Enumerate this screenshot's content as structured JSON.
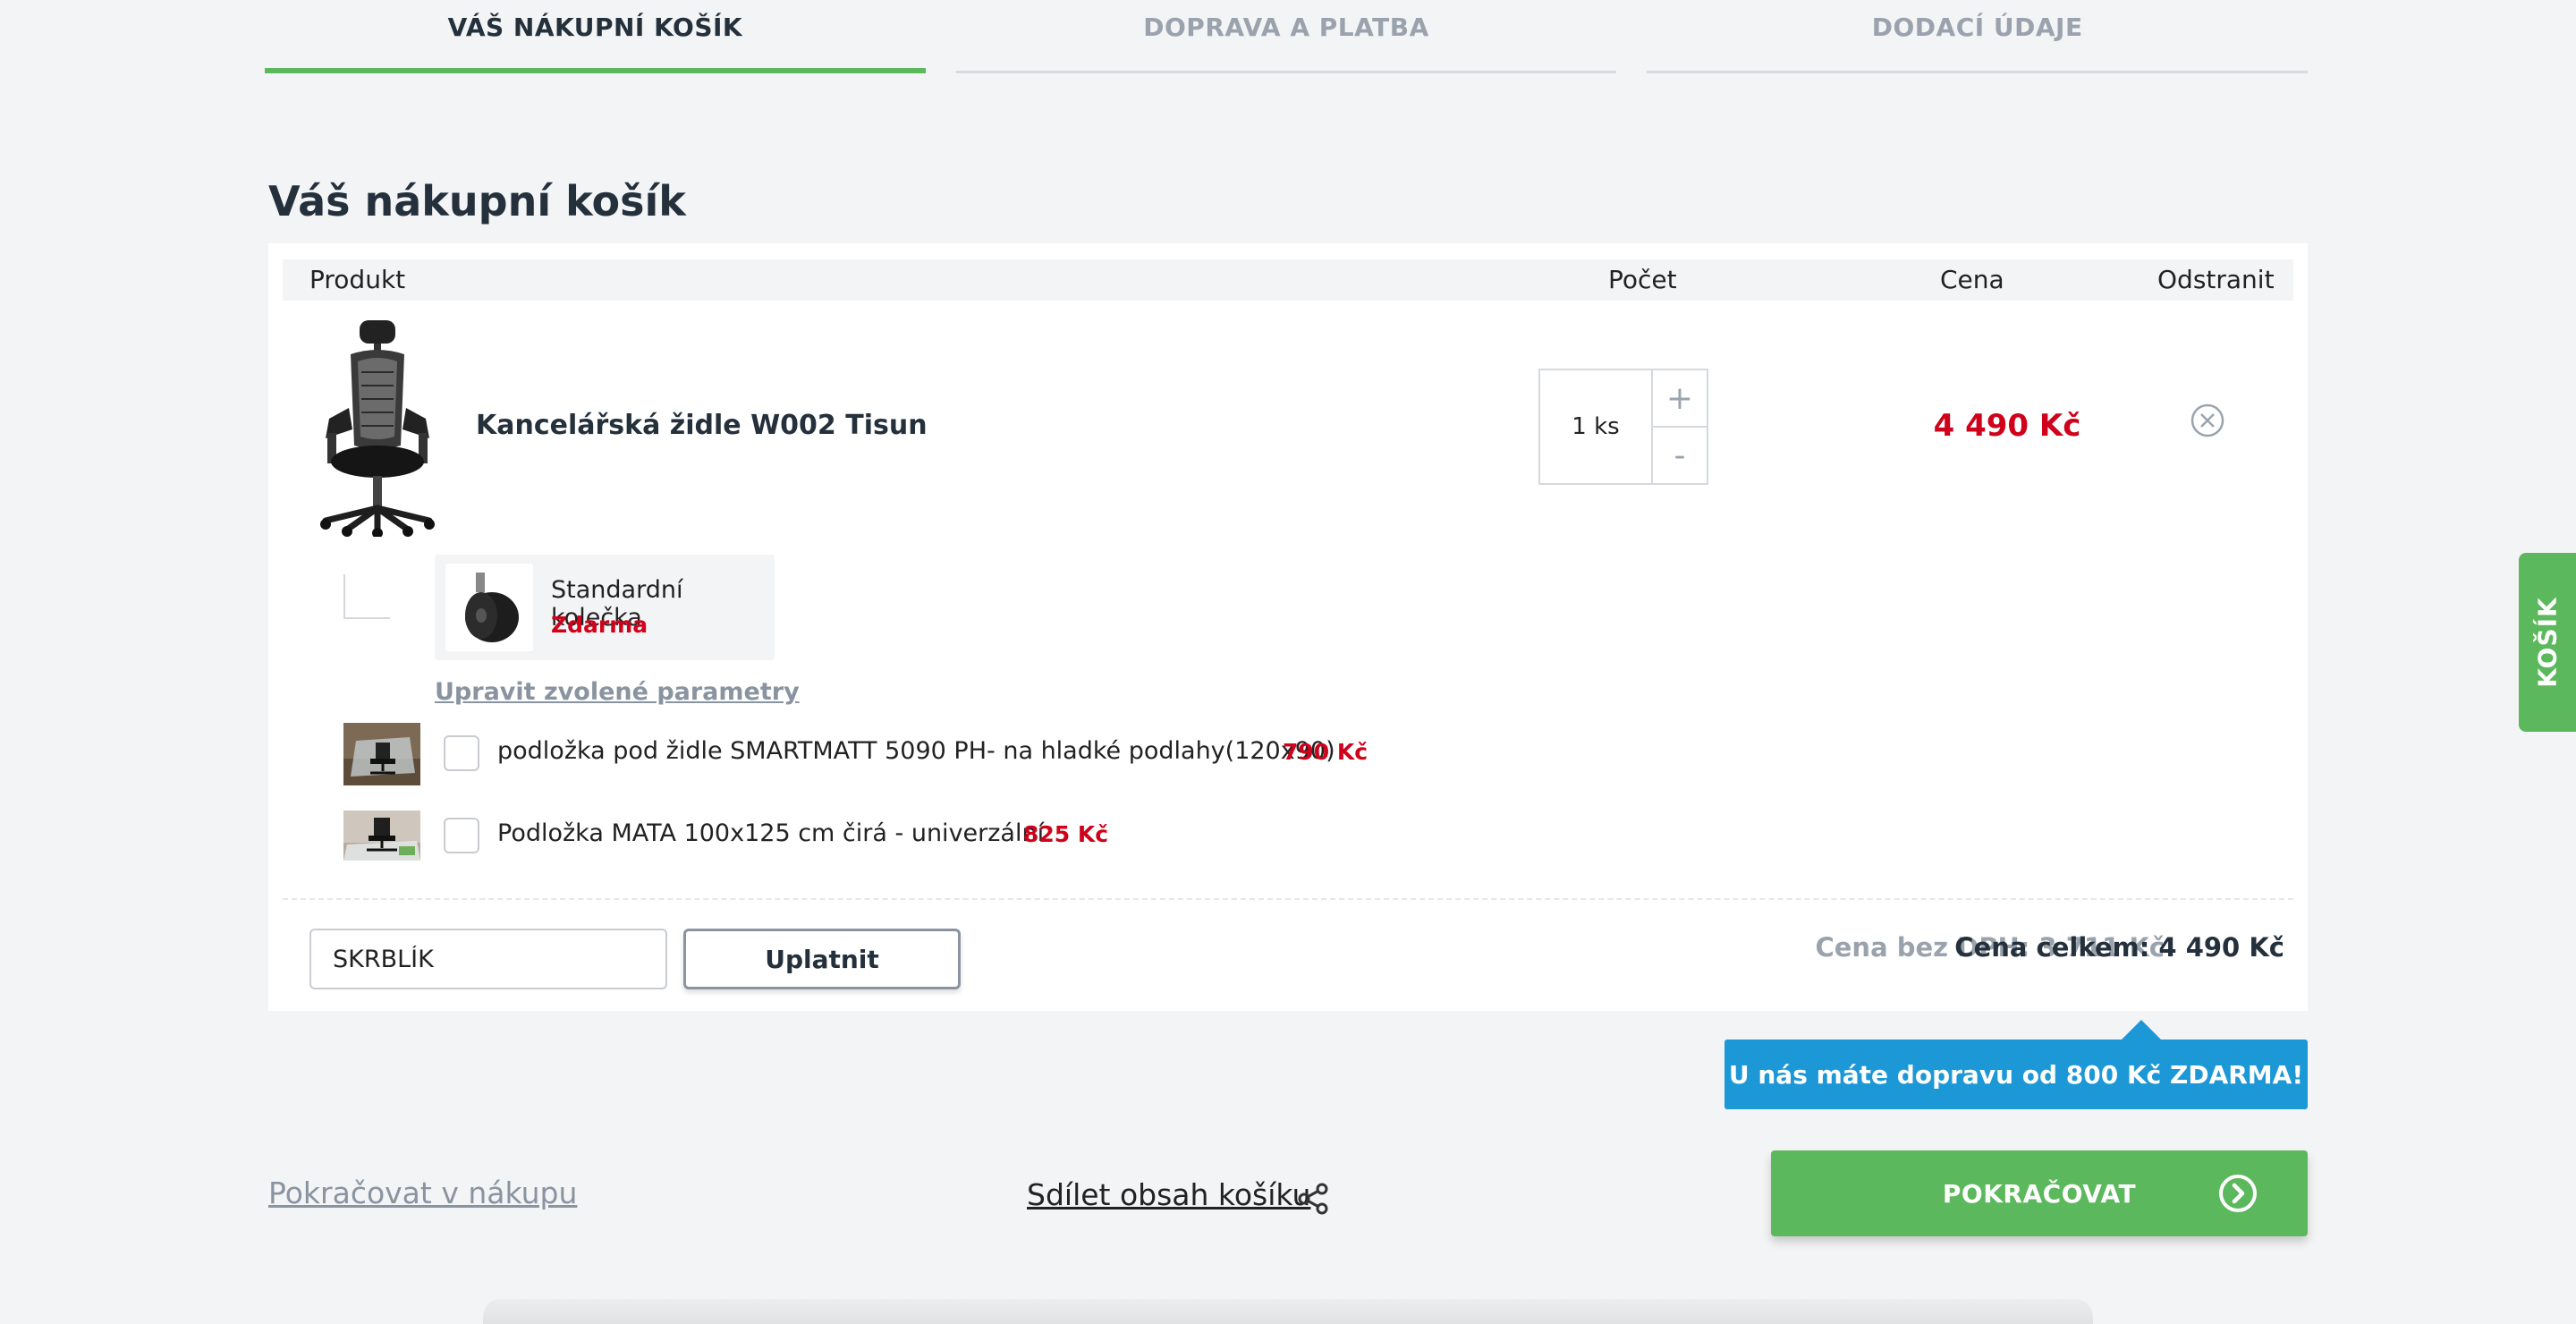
{
  "steps": [
    {
      "label": "VÁŠ NÁKUPNÍ KOŠÍK",
      "active": true
    },
    {
      "label": "DOPRAVA A PLATBA",
      "active": false
    },
    {
      "label": "DODACÍ ÚDAJE",
      "active": false
    }
  ],
  "page_title": "Váš nákupní košík",
  "table_headers": {
    "product": "Produkt",
    "quantity": "Počet",
    "price": "Cena",
    "remove": "Odstranit"
  },
  "item": {
    "name": "Kancelářská židle W002 Tisun",
    "quantity": "1 ks",
    "plus": "+",
    "minus": "-",
    "price": "4 490 Kč",
    "param": {
      "name": "Standardní kolečka",
      "price": "Zdarma"
    },
    "edit_link": "Upravit zvolené parametry"
  },
  "addons": [
    {
      "name": "podložka pod židle SMARTMATT 5090 PH- na hladké podlahy(120x90)",
      "price": "790 Kč",
      "checked": false
    },
    {
      "name": "Podložka MATA 100x125 cm čirá - univerzální",
      "price": "825 Kč",
      "checked": false
    }
  ],
  "coupon": {
    "value": "SKRBLÍK",
    "apply_label": "Uplatnit"
  },
  "totals": {
    "without_vat": "Cena bez DPH: 3 711 Kč",
    "total": "Cena celkem: 4 490 Kč"
  },
  "free_shipping": "U nás máte dopravu od 800 Kč ZDARMA!",
  "continue_shopping": "Pokračovat v nákupu",
  "share_cart": "Sdílet obsah košíku",
  "proceed": "POKRAČOVAT",
  "side_tab": "KOŠÍK",
  "colors": {
    "green": "#5cb85c",
    "blue": "#1c98d6",
    "red": "#d0021b",
    "dark": "#24303b",
    "muted": "#9aa3ad"
  }
}
